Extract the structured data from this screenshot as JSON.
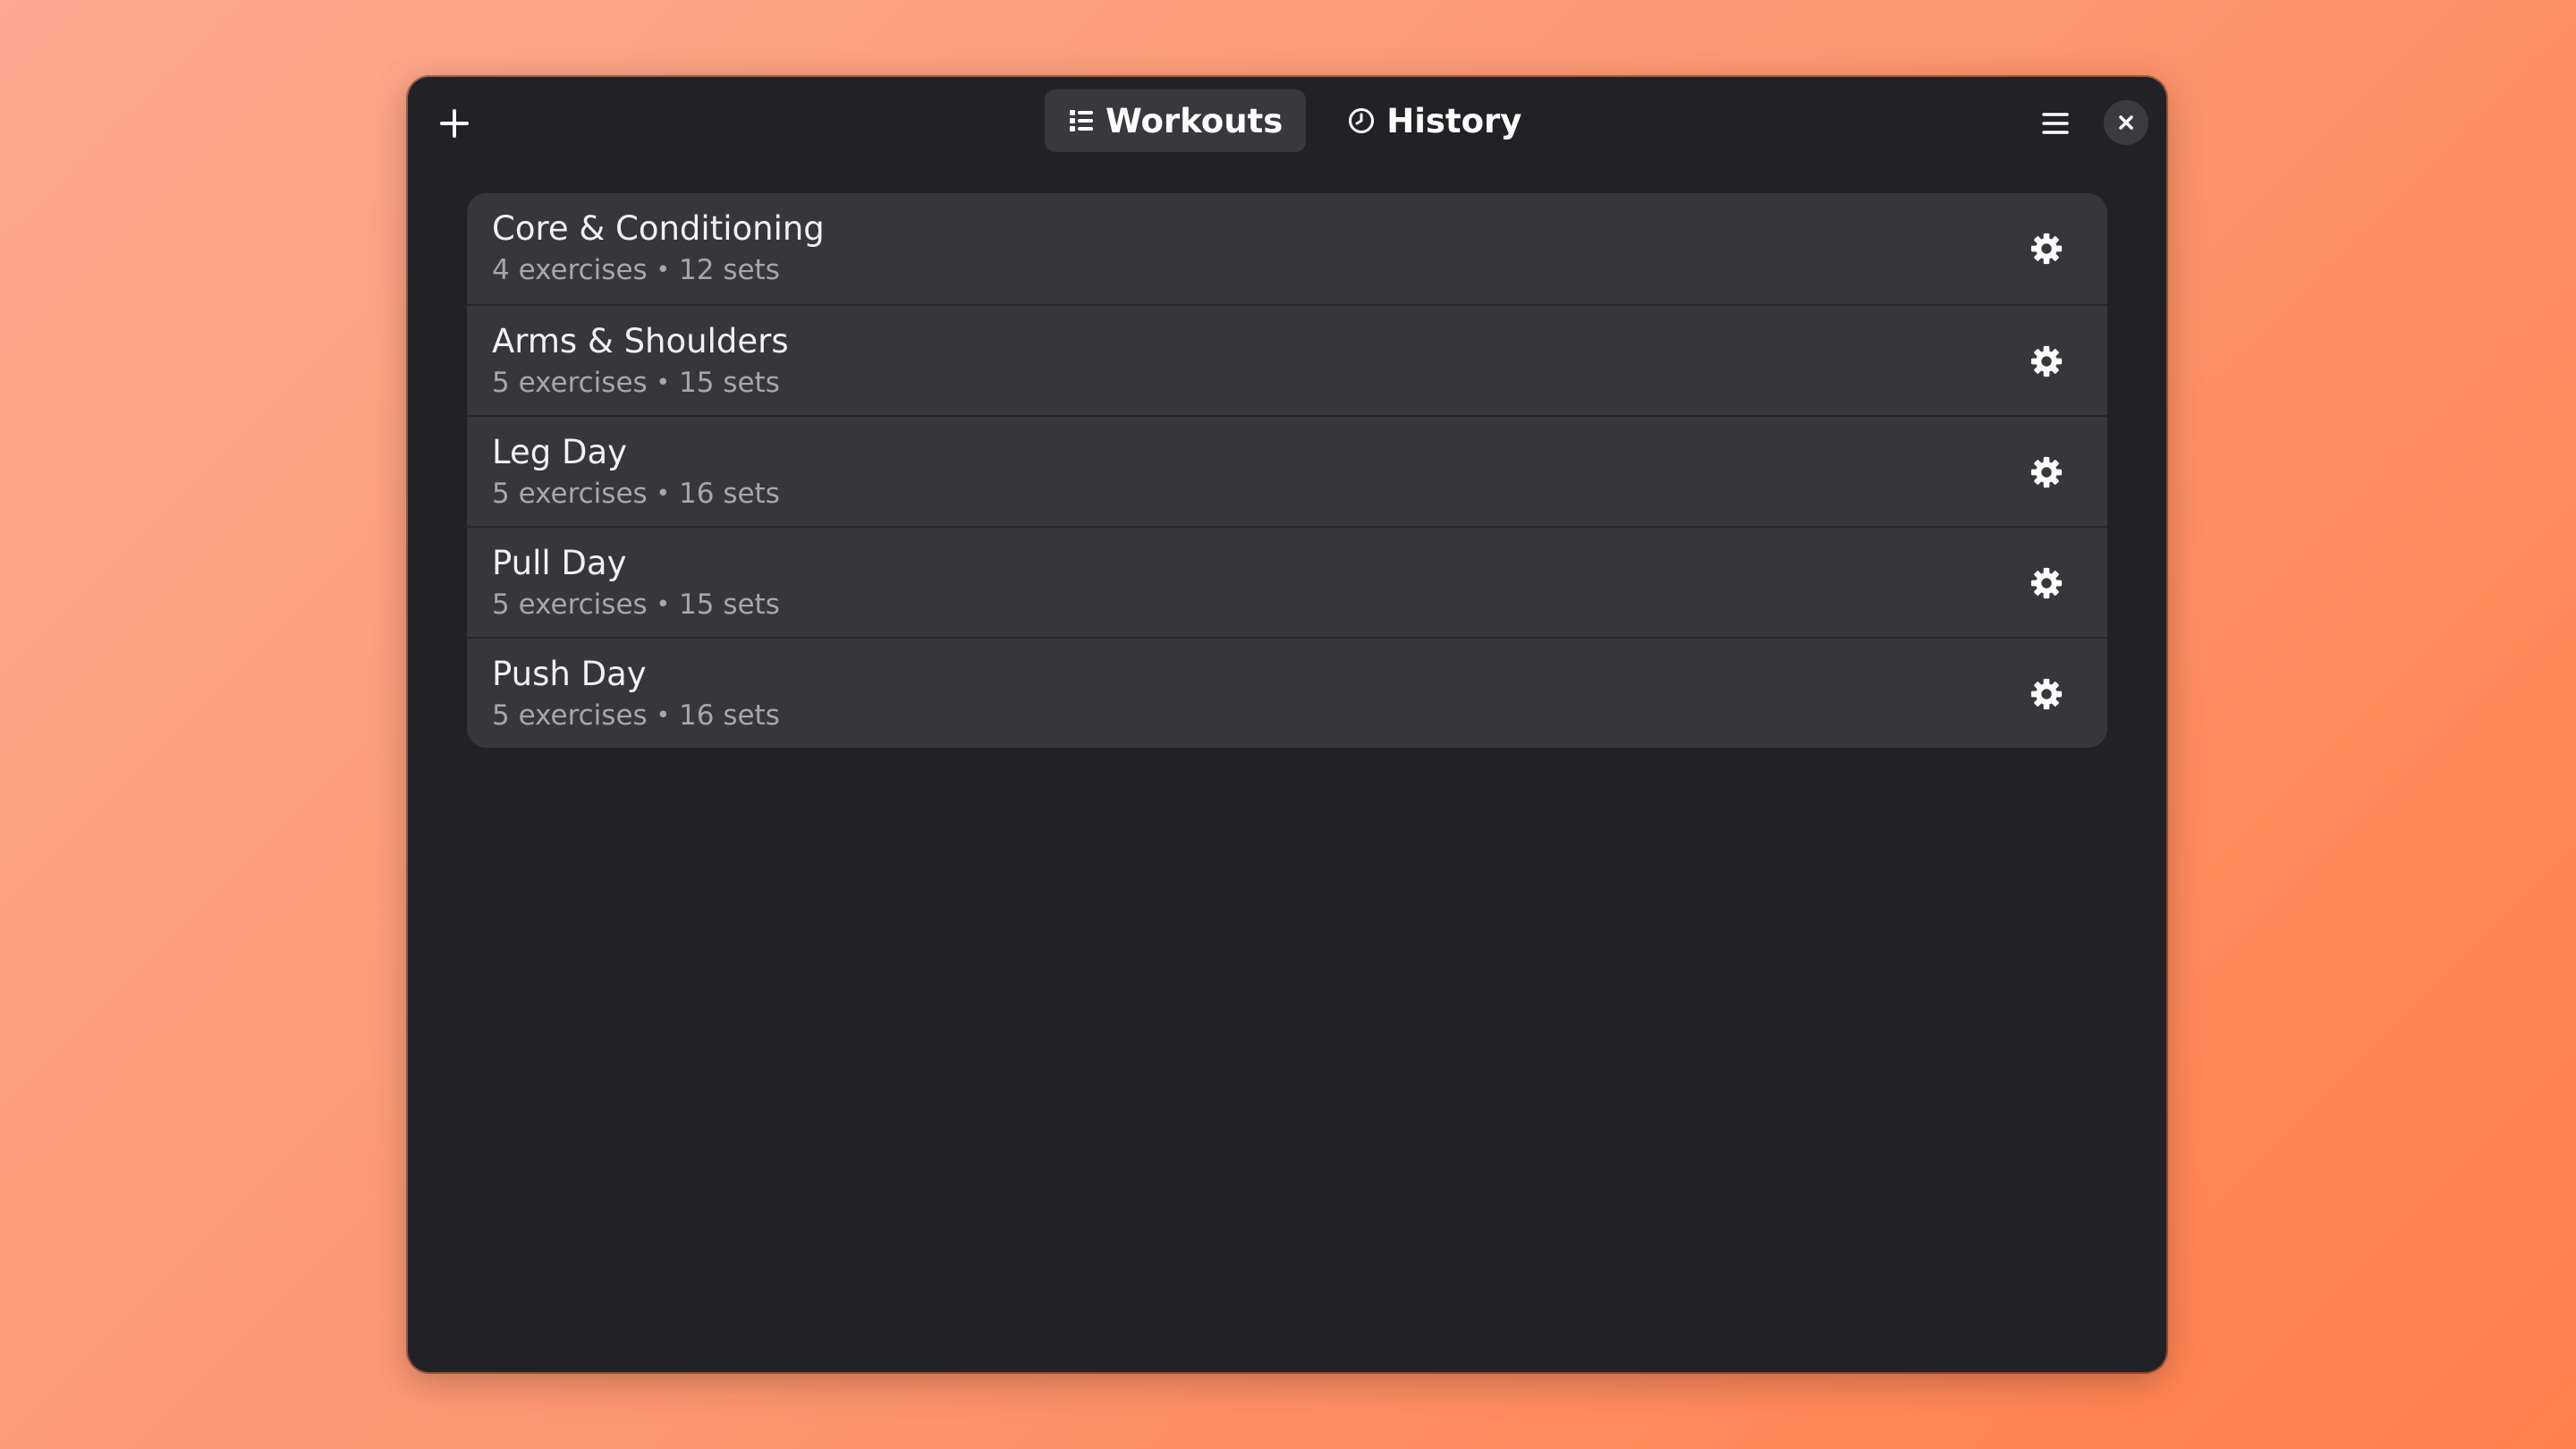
{
  "header": {
    "add_icon": "plus-icon",
    "tabs": [
      {
        "label": "Workouts",
        "icon": "list-icon",
        "active": true
      },
      {
        "label": "History",
        "icon": "clock-icon",
        "active": false
      }
    ],
    "menu_icon": "hamburger-menu-icon",
    "close_icon": "close-icon"
  },
  "workouts": [
    {
      "name": "Core & Conditioning",
      "exercises": "4 exercises",
      "sets": "12 sets",
      "separator": "•"
    },
    {
      "name": "Arms & Shoulders",
      "exercises": "5 exercises",
      "sets": "15 sets",
      "separator": "•"
    },
    {
      "name": "Leg Day",
      "exercises": "5 exercises",
      "sets": "16 sets",
      "separator": "•"
    },
    {
      "name": "Pull Day",
      "exercises": "5 exercises",
      "sets": "15 sets",
      "separator": "•"
    },
    {
      "name": "Push Day",
      "exercises": "5 exercises",
      "sets": "16 sets",
      "separator": "•"
    }
  ],
  "colors": {
    "window_bg": "#222226",
    "card_bg": "#36363b",
    "active_tab_bg": "#38383d",
    "text_primary": "#f2f2f3",
    "text_secondary": "#a7a7ab"
  }
}
